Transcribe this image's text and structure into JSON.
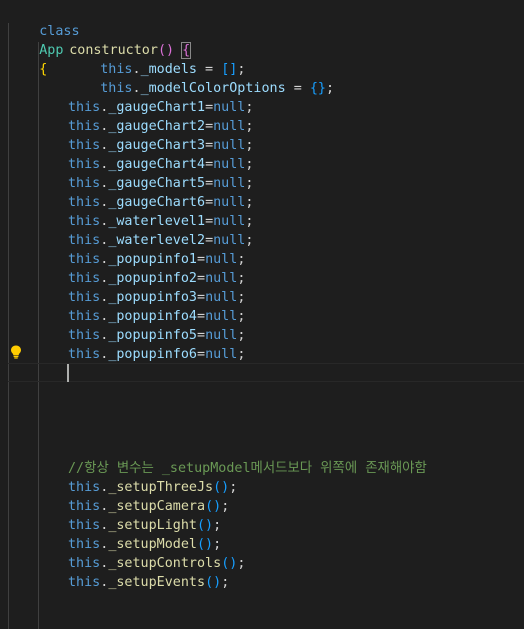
{
  "code": {
    "class_keyword": "class",
    "class_name": "App",
    "constructor_name": "constructor",
    "this_keyword": "this",
    "null_keyword": "null",
    "models": "_models",
    "model_color_options": "_modelColorOptions",
    "null_fields": [
      "_gaugeChart1",
      "_gaugeChart2",
      "_gaugeChart3",
      "_gaugeChart4",
      "_gaugeChart5",
      "_gaugeChart6",
      "_waterlevel1",
      "_waterlevel2",
      "_popupinfo1",
      "_popupinfo2",
      "_popupinfo3",
      "_popupinfo4",
      "_popupinfo5",
      "_popupinfo6"
    ],
    "comment": "//항상 변수는 _setupModel메서드보다 위쪽에 존재해야함",
    "setup_calls": [
      "_setupThreeJs",
      "_setupCamera",
      "_setupLight",
      "_setupModel",
      "_setupControls",
      "_setupEvents"
    ]
  },
  "colors": {
    "background": "#1e1e1e",
    "keyword": "#569cd6",
    "class_name": "#4ec9b0",
    "function": "#dcdcaa",
    "property": "#9cdcfe",
    "comment": "#6a9955",
    "bracket_gold": "#ffd700",
    "bracket_purple": "#da70d6",
    "bracket_blue": "#179fff"
  },
  "icons": {
    "lightbulb": "lightbulb-icon"
  }
}
